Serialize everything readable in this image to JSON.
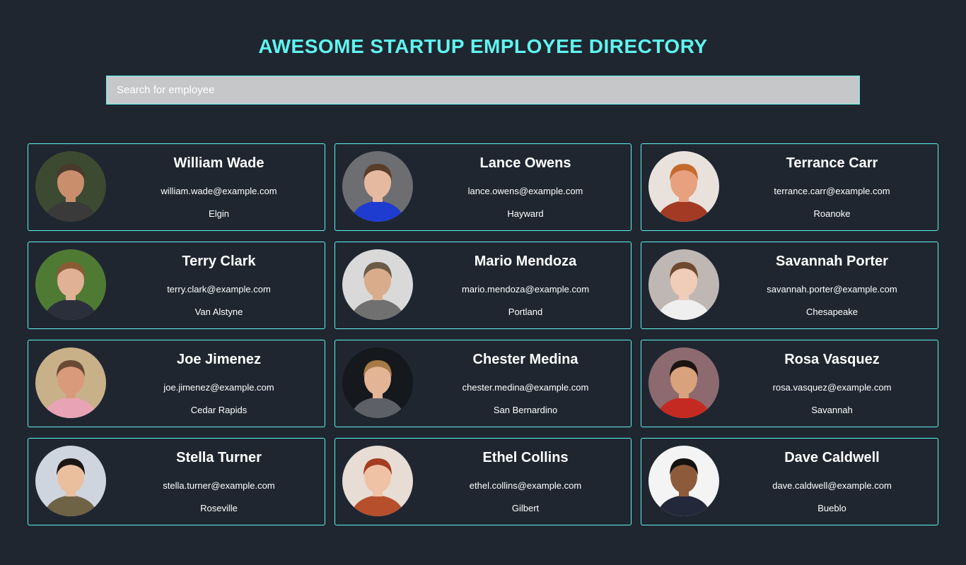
{
  "header": {
    "title": "AWESOME STARTUP EMPLOYEE DIRECTORY"
  },
  "search": {
    "placeholder": "Search for employee",
    "value": ""
  },
  "colors": {
    "accent": "#5ff5ee",
    "background": "#1f2630",
    "search_bg": "#c6c7c9"
  },
  "employees": [
    {
      "name": "William Wade",
      "email": "william.wade@example.com",
      "city": "Elgin",
      "avatar": {
        "bg": "#3c4a32",
        "skin": "#c98f6d",
        "hair": "#4a3a2c",
        "shirt": "#3a3a3a"
      }
    },
    {
      "name": "Lance Owens",
      "email": "lance.owens@example.com",
      "city": "Hayward",
      "avatar": {
        "bg": "#6d6e72",
        "skin": "#e4b9a0",
        "hair": "#5a3d28",
        "shirt": "#1e3ccf"
      }
    },
    {
      "name": "Terrance Carr",
      "email": "terrance.carr@example.com",
      "city": "Roanoke",
      "avatar": {
        "bg": "#e9e2dc",
        "skin": "#e7a17e",
        "hair": "#c46a2d",
        "shirt": "#a33a24"
      }
    },
    {
      "name": "Terry Clark",
      "email": "terry.clark@example.com",
      "city": "Van Alstyne",
      "avatar": {
        "bg": "#4f7a34",
        "skin": "#e0b194",
        "hair": "#8a5a36",
        "shirt": "#2b2f3c"
      }
    },
    {
      "name": "Mario Mendoza",
      "email": "mario.mendoza@example.com",
      "city": "Portland",
      "avatar": {
        "bg": "#d9d9d9",
        "skin": "#d9ac8c",
        "hair": "#6b5a45",
        "shirt": "#707070"
      }
    },
    {
      "name": "Savannah Porter",
      "email": "savannah.porter@example.com",
      "city": "Chesapeake",
      "avatar": {
        "bg": "#bfb7b3",
        "skin": "#f0cdb8",
        "hair": "#6e4a30",
        "shirt": "#efefef"
      }
    },
    {
      "name": "Joe Jimenez",
      "email": "joe.jimenez@example.com",
      "city": "Cedar Rapids",
      "avatar": {
        "bg": "#c8b089",
        "skin": "#d99a7b",
        "hair": "#6a4a33",
        "shirt": "#e8a3b4"
      }
    },
    {
      "name": "Chester Medina",
      "email": "chester.medina@example.com",
      "city": "San Bernardino",
      "avatar": {
        "bg": "#15181c",
        "skin": "#e4b496",
        "hair": "#a67a45",
        "shirt": "#5d6066"
      }
    },
    {
      "name": "Rosa Vasquez",
      "email": "rosa.vasquez@example.com",
      "city": "Savannah",
      "avatar": {
        "bg": "#8c6a70",
        "skin": "#d7a27c",
        "hair": "#1b1410",
        "shirt": "#c52a22"
      }
    },
    {
      "name": "Stella Turner",
      "email": "stella.turner@example.com",
      "city": "Roseville",
      "avatar": {
        "bg": "#cfd5de",
        "skin": "#e9bf9e",
        "hair": "#1b1613",
        "shirt": "#6f6346"
      }
    },
    {
      "name": "Ethel Collins",
      "email": "ethel.collins@example.com",
      "city": "Gilbert",
      "avatar": {
        "bg": "#e7ddd5",
        "skin": "#f0c2a5",
        "hair": "#a43c20",
        "shirt": "#b64f2c"
      }
    },
    {
      "name": "Dave Caldwell",
      "email": "dave.caldwell@example.com",
      "city": "Bueblo",
      "avatar": {
        "bg": "#f4f4f4",
        "skin": "#8e5a3c",
        "hair": "#161210",
        "shirt": "#23283a"
      }
    }
  ]
}
